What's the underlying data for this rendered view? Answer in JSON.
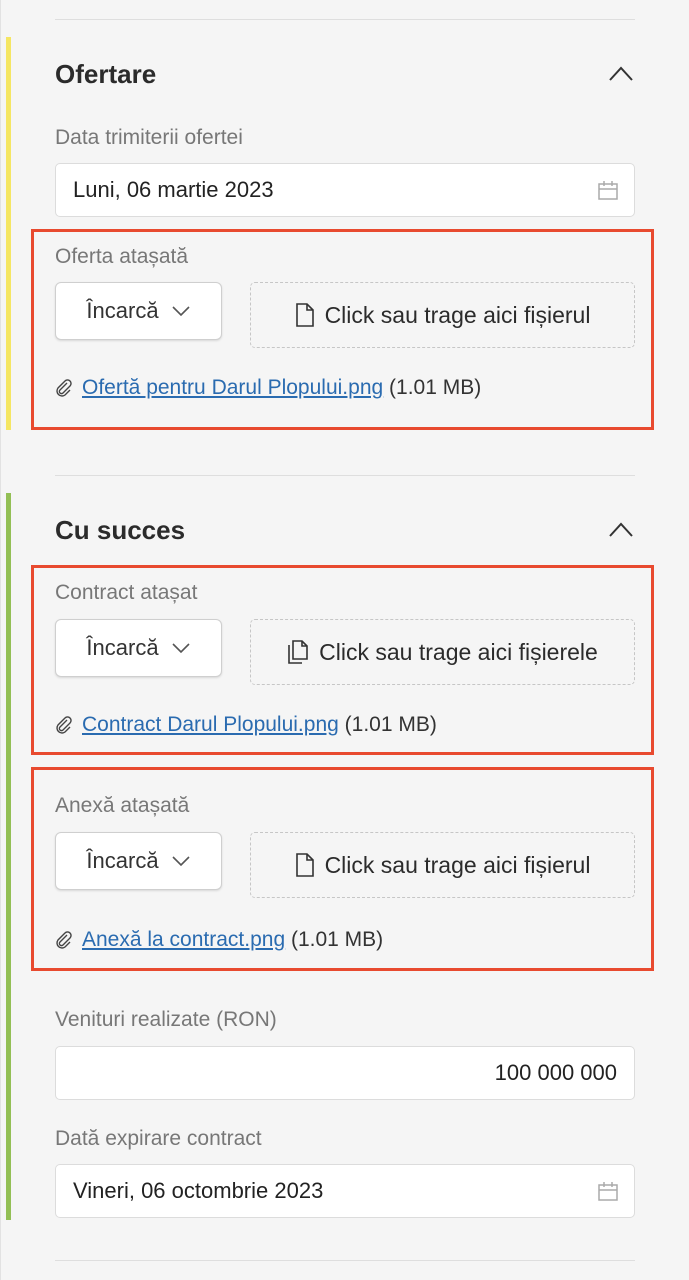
{
  "ofertare": {
    "title": "Ofertare",
    "data_label": "Data trimiterii ofertei",
    "data_value": "Luni, 06 martie 2023",
    "offer": {
      "label": "Oferta atașată",
      "upload_label": "Încarcă",
      "drop_text": "Click sau trage aici fișierul",
      "file_name": "Ofertă pentru Darul Plopului.png",
      "file_size": "(1.01 MB)"
    }
  },
  "succes": {
    "title": "Cu succes",
    "contract": {
      "label": "Contract atașat",
      "upload_label": "Încarcă",
      "drop_text": "Click sau trage aici fișierele",
      "file_name": "Contract Darul Plopului.png",
      "file_size": "(1.01 MB)"
    },
    "anexa": {
      "label": "Anexă atașată",
      "upload_label": "Încarcă",
      "drop_text": "Click sau trage aici fișierul",
      "file_name": "Anexă la contract.png",
      "file_size": "(1.01 MB)"
    },
    "venituri_label": "Venituri realizate (RON)",
    "venituri_value": "100 000 000",
    "expirare_label": "Dată expirare contract",
    "expirare_value": "Vineri, 06 octombrie 2023"
  },
  "colors": {
    "ofertare_stripe": "#f5e663",
    "succes_stripe": "#93bf55",
    "highlight_box": "#e84a2f",
    "link": "#2a6bb0"
  },
  "icons": [
    "chevron-up-icon",
    "calendar-icon",
    "chevron-down-icon",
    "file-icon",
    "files-icon",
    "paperclip-icon"
  ]
}
